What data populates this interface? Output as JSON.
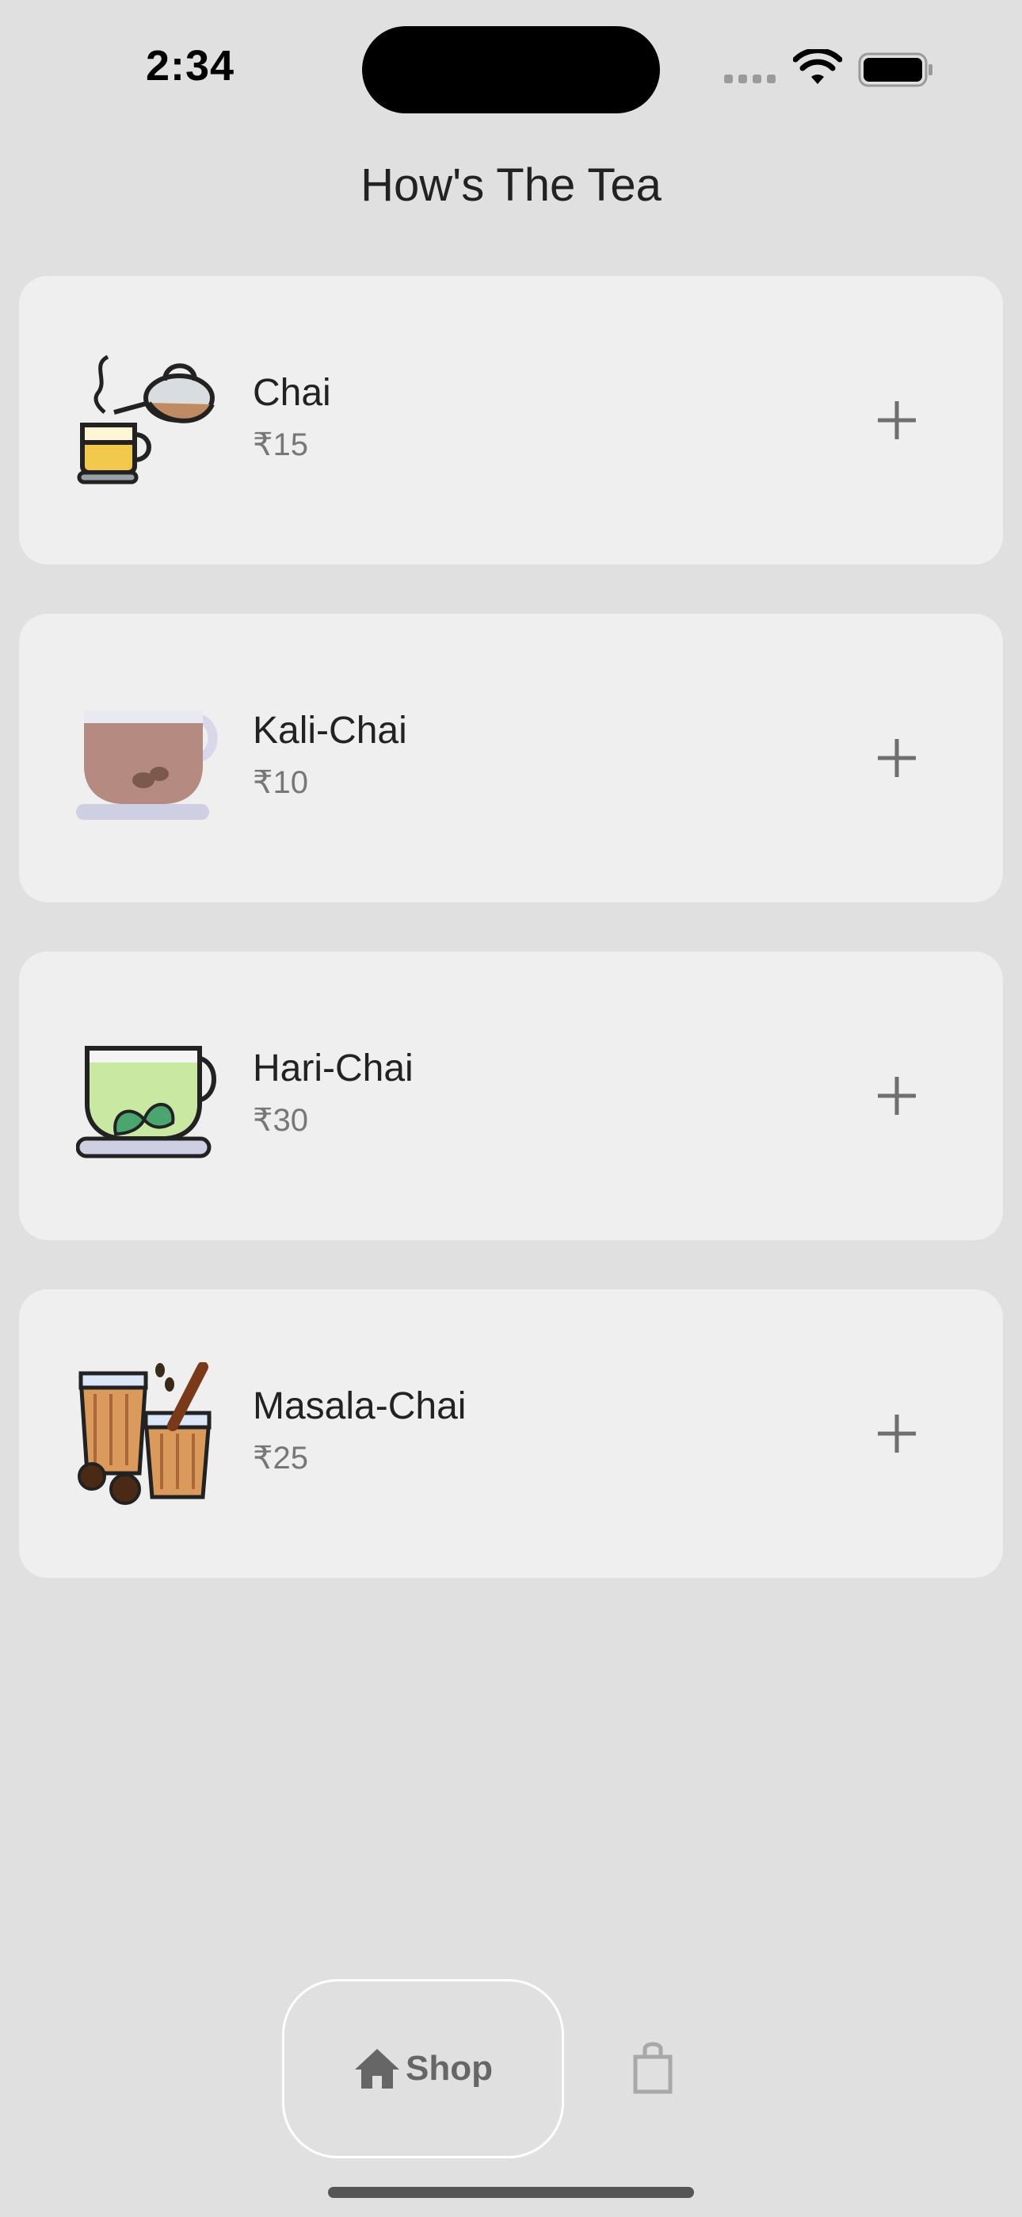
{
  "status_bar": {
    "time": "2:34"
  },
  "page": {
    "title": "How's The Tea"
  },
  "products": [
    {
      "name": "Chai",
      "price": "₹15",
      "image_icon": "chai-kettle-icon"
    },
    {
      "name": "Kali-Chai",
      "price": "₹10",
      "image_icon": "black-tea-cup-icon"
    },
    {
      "name": "Hari-Chai",
      "price": "₹30",
      "image_icon": "green-tea-cup-icon"
    },
    {
      "name": "Masala-Chai",
      "price": "₹25",
      "image_icon": "masala-chai-glasses-icon"
    }
  ],
  "bottom_nav": {
    "shop_label": "Shop",
    "active": "shop"
  },
  "colors": {
    "background": "#e0e0e0",
    "card": "#efefef",
    "text": "#222222",
    "muted": "#777777"
  }
}
